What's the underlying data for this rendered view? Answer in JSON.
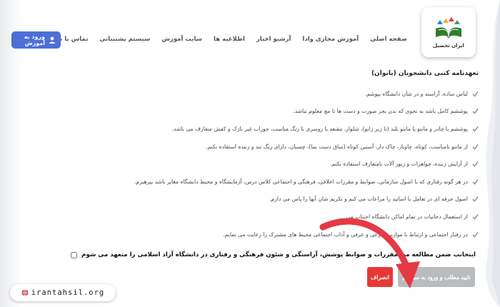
{
  "header": {
    "logo_text": "ایران تحصیل",
    "nav": [
      "صفحه اصلی",
      "آموزش مجازی وادا",
      "آرشیو اخبار",
      "اطلاعیه ها",
      "سایت آموزش",
      "سیستم پشتیبانی",
      "تماس با ما"
    ],
    "login_label": "ورود به آموزش"
  },
  "content": {
    "title": "تعهدنامه کتبی دانشجویان (بانوان)",
    "rules": [
      "لباس ساده، آراسته و در شأن دانشگاه بپوشم.",
      "پوششم کامل باشد به نحوی که بدن بجز صورت و دست ها تا مچ معلوم نباشد.",
      "پوششم با چادر و مانتو یا مانتو بلند (تا زیر زانو)، شلوار، مقنعه یا روسری با رنگ مناسب، جوراب غیر نازک و کفش متعارف می باشد.",
      "از مانتو نامناسب، کوتاه، چاوباز، چاک دار، آستین کوتاه (ساق دست نما)، چسبان، دارای رنگ تند و زننده استفاده نکنم.",
      "از آرایش زننده، جواهرات و زیور آلات نامتعارف استفاده نکنم.",
      "در هر گونه رفتاری که با اصول سازمانی، ضوابط و مقررات اخلاقی، فرهنگی و اجتماعی کلاس درس، آزمایشگاه و محیط دانشگاه مغایر باشد بپرهیزم.",
      "اصول حرفه ای در تعامل با اساتید را مراعات می کنم و تکریم شان آنها را پاس می دارم.",
      "از استعمال دخانیات در تمام اماکن دانشگاه اجتناب می",
      "در رفتار اجتماعی و ارتباط با   موازین شرعی و عرفی و آداب اجتماعی محیط های مشترک را رعایت می نمایم."
    ],
    "agreement": "اینجانب ضمن مطالعه موا   مقررات و ضوابط پوشش، آراستگی و شئون فرهنگی و رفتاری در دانشگاه آزاد اسلامی را متعهد می شوم"
  },
  "buttons": {
    "confirm": "تایید مطلب و ورود به سیستم",
    "cancel": "انصراف"
  },
  "watermark": "irantahsil.org",
  "colors": {
    "login_button": "#4d6fd9",
    "cancel_button": "#e53935",
    "confirm_button": "#b9bcbf",
    "arrow": "#e53945",
    "check": "#8a8f96"
  }
}
